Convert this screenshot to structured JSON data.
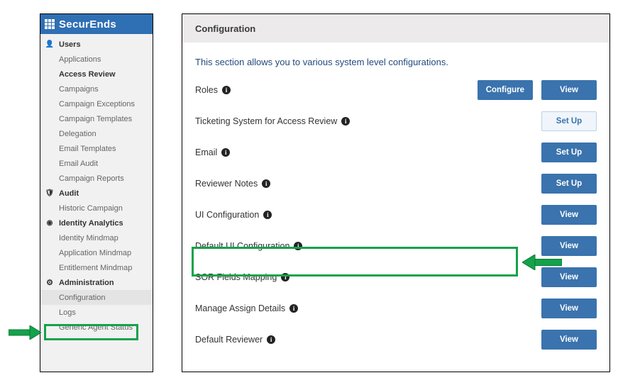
{
  "brand": "SecurEnds",
  "sidebar": {
    "sections": [
      {
        "icon": "user",
        "label": "Users",
        "children": [
          "Applications"
        ]
      },
      {
        "icon": "grid",
        "label": "Access Review",
        "children": [
          "Campaigns",
          "Campaign Exceptions",
          "Campaign Templates",
          "Delegation",
          "Email Templates",
          "Email Audit",
          "Campaign Reports"
        ]
      },
      {
        "icon": "shield",
        "label": "Audit",
        "children": [
          "Historic Campaign"
        ]
      },
      {
        "icon": "finger",
        "label": "Identity Analytics",
        "children": [
          "Identity Mindmap",
          "Application Mindmap",
          "Entitlement Mindmap"
        ]
      },
      {
        "icon": "gear",
        "label": "Administration",
        "children": [
          "Configuration",
          "Logs",
          "Generic Agent Status"
        ]
      }
    ],
    "selected_child": "Configuration"
  },
  "main": {
    "title": "Configuration",
    "description": "This section allows you to various system level configurations.",
    "button_labels": {
      "configure": "Configure",
      "view": "View",
      "setup": "Set Up"
    },
    "rows": [
      {
        "label": "Roles",
        "primary": "Configure",
        "secondary": "View"
      },
      {
        "label": "Ticketing System for Access Review",
        "primary": "Set Up",
        "primary_outline": true
      },
      {
        "label": "Email",
        "primary": "Set Up"
      },
      {
        "label": "Reviewer Notes",
        "primary": "Set Up"
      },
      {
        "label": "UI Configuration",
        "primary": "View"
      },
      {
        "label": "Default UI Configuration",
        "primary": "View",
        "highlight": true
      },
      {
        "label": "SOR Fields Mapping",
        "primary": "View"
      },
      {
        "label": "Manage Assign Details",
        "primary": "View"
      },
      {
        "label": "Default Reviewer",
        "primary": "View"
      }
    ]
  },
  "annotation_color": "#14a24a"
}
